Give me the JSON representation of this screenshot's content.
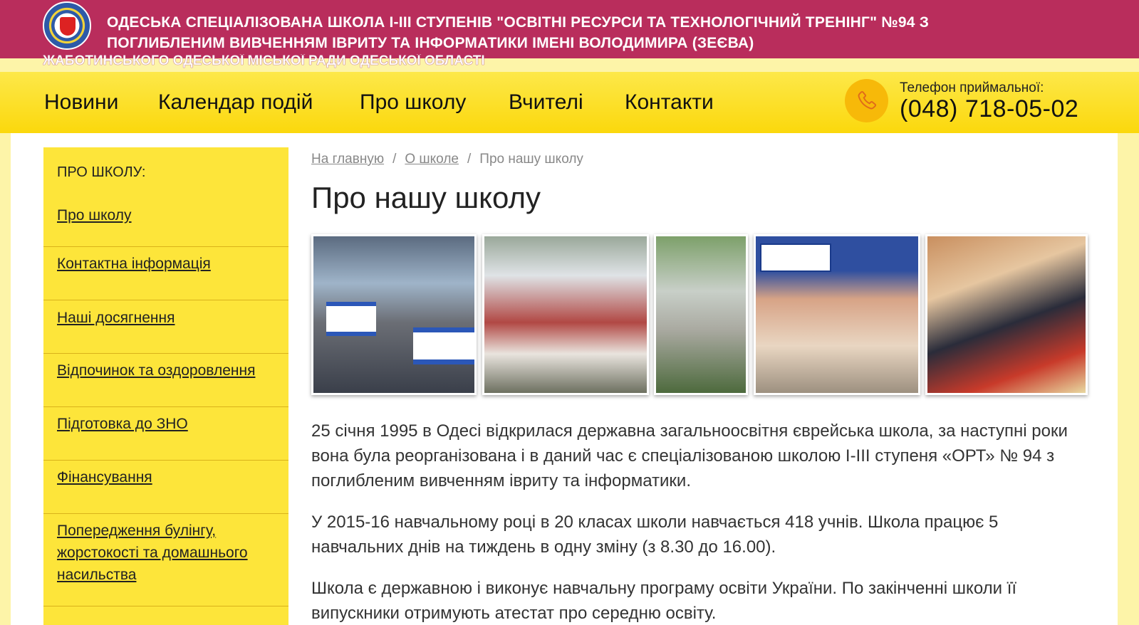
{
  "header": {
    "title": "ОДЕСЬКА СПЕЦІАЛІЗОВАНА  ШКОЛА І-ІІІ СТУПЕНІВ \"ОСВІТНІ РЕСУРСИ ТА ТЕХНОЛОГІЧНИЙ ТРЕНІНГ\" №94  З ПОГЛИБЛЕНИМ ВИВЧЕННЯМ ІВРИТУ ТА ІНФОРМАТИКИ ІМЕНІ ВОЛОДИМИРА (ЗЕЄВА)",
    "subtitle": "ЖАБОТИНСЬКОГО ОДЕСЬКОЇ МІСЬКОЇ РАДИ ОДЕСЬКОЇ ОБЛАСТІ",
    "brand_color": "#b92d5c"
  },
  "nav": {
    "items": [
      "Новини",
      "Календар подій",
      "Про школу",
      "Вчителі",
      "Контакти"
    ],
    "phone_label": "Телефон приймальної:",
    "phone_number": "(048) 718-05-02",
    "accent_color": "#fbd80c"
  },
  "sidebar": {
    "title": "Про школу:",
    "items": [
      "Про школу",
      "Контактна інформація",
      "Наші досягнення",
      "Відпочинок та оздоровлення",
      "Підготовка до ЗНО",
      "Фінансування",
      "Попередження булінгу, жорстокості та домашнього насильства"
    ]
  },
  "breadcrumb": {
    "home": "На главную",
    "section": "О школе",
    "current": "Про нашу школу"
  },
  "main": {
    "title": "Про нашу школу",
    "photos": [
      "students-with-flags",
      "graduates-group",
      "school-building",
      "teacher-with-microphone",
      "students-robotics"
    ],
    "paragraphs": [
      "25 січня 1995 в Одесі відкрилася державна загальноосвітня єврейська школа, за наступні роки вона була реорганізована і в даний час є спеціалізованою школою І-ІІІ ступеня «ОРТ» № 94 з поглибленим вивченням івриту та інформатики.",
      "У 2015-16 навчальному році в 20 класах школи навчається 418 учнів. Школа працює 5 навчальних днів на тиждень в одну зміну (з 8.30 до 16.00).",
      "Школа є державною і виконує навчальну програму освіти України. По закінченні школи її випускники отримують атестат про середню освіту."
    ]
  }
}
